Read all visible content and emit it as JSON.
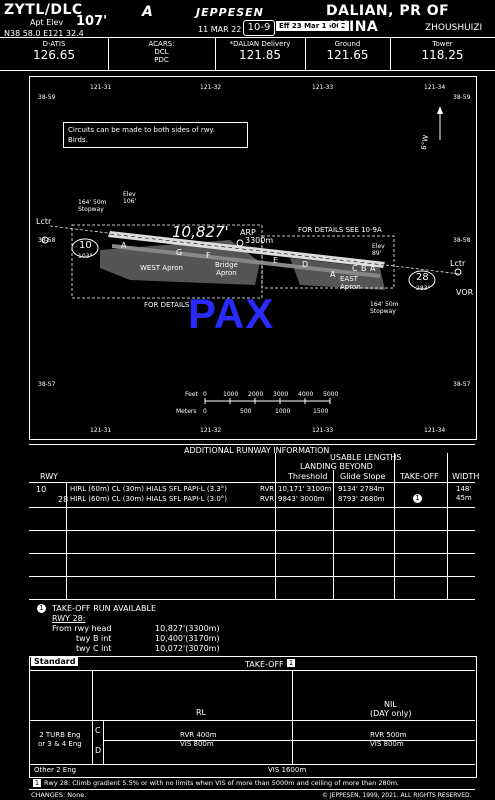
{
  "header": {
    "ident": "ZYTL/DLC",
    "apt_elev_label": "Apt Elev",
    "apt_elev": "107'",
    "coords": "N38 58.0  E121 32.4",
    "brand": "JEPPESEN",
    "date": "11 MAR 22",
    "chart_no": "10-9",
    "effective": "Eff 23 Mar 1600Z",
    "city": "DALIAN, PR OF CHINA",
    "airport": "ZHOUSHUIZI"
  },
  "frequencies": [
    {
      "label": "D-ATIS",
      "value": "126.65"
    },
    {
      "label": "ACARS:",
      "sub": "DCL\nPDC",
      "value": ""
    },
    {
      "label": "*DALIAN Delivery",
      "value": "121.85"
    },
    {
      "label": "Ground",
      "value": "121.65"
    },
    {
      "label": "Tower",
      "value": "118.25"
    }
  ],
  "map": {
    "lon_ticks": [
      "121-31",
      "121-32",
      "121-33",
      "121-34"
    ],
    "lat_ticks": [
      "38-59",
      "38-58",
      "38-57"
    ],
    "note": "Circuits can be made to both sides of rwy.\nBirds.",
    "var": "6°W",
    "runway_length": "10,827'",
    "runway_length_m": "3300m",
    "rwy10": "10",
    "rwy10_hdg": "103°",
    "rwy28": "28",
    "rwy28_hdg": "283°",
    "elev_w": "Elev\n106'",
    "elev_e": "Elev\n89'",
    "stopway_w": "164' 50m\nStopway",
    "stopway_e": "164' 50m\nStopway",
    "arp": "ARP",
    "for_details_1": "FOR DETAILS SEE 10-9A",
    "for_details_2": "FOR DETAILS",
    "west_apron": "WEST Apron",
    "bridge_apron": "Bridge\nApron",
    "east_apron": "EAST\nApron",
    "taxiways": [
      "A",
      "G",
      "F",
      "E",
      "D",
      "A",
      "C",
      "B",
      "A"
    ],
    "lctr": "Lctr",
    "vor": "VOR",
    "watermark": "PAX",
    "scale_feet_label": "Feet",
    "scale_feet": [
      "0",
      "1000",
      "2000",
      "3000",
      "4000",
      "5000"
    ],
    "scale_m_label": "Meters",
    "scale_m": [
      "0",
      "500",
      "1000",
      "1500"
    ]
  },
  "add_rwy_info": {
    "title": "ADDITIONAL RUNWAY INFORMATION",
    "usable": "USABLE LENGTHS",
    "landing_beyond": "LANDING BEYOND",
    "threshold": "Threshold",
    "glide_slope": "Glide Slope",
    "takeoff": "TAKE-OFF",
    "width": "WIDTH",
    "rwy": "RWY",
    "rows": [
      {
        "rwy": "10",
        "lights": "HIRL (60m)  CL (30m)  HIALS  SFL  PAPI-L (3.3°)",
        "rvr": "RVR",
        "thr": "10,171' 3100m",
        "gs": "9134' 2784m",
        "to": "",
        "width": "148'\n45m"
      },
      {
        "rwy": "28",
        "lights": "HIRL (60m)  CL (30m)  HIALS  SFL  PAPI-L (3.0°)",
        "rvr": "RVR",
        "thr": "9843' 3000m",
        "gs": "8793' 2680m",
        "to": "1",
        "width": ""
      }
    ]
  },
  "takeoff_run": {
    "title": "TAKE-OFF RUN AVAILABLE",
    "rwy": "RWY 28:",
    "rows": [
      {
        "label": "From rwy head",
        "value": "10,827'(3300m)"
      },
      {
        "label": "twy B int",
        "value": "10,400'(3170m)"
      },
      {
        "label": "twy C int",
        "value": "10,072'(3070m)"
      }
    ]
  },
  "takeoff_table": {
    "standard": "Standard",
    "title": "TAKE-OFF",
    "rl": "RL",
    "nil": "NIL",
    "nil_sub": "(DAY only)",
    "eng_label": "2 TURB Eng\nor 3 & 4 Eng",
    "c": "C",
    "d": "D",
    "c_rl": "RVR 400m\nVIS 800m",
    "c_nil": "RVR 500m\nVIS 800m",
    "other": "Other 2 Eng",
    "other_val": "VIS 1600m"
  },
  "footnote": "Rwy 28: Climb gradient 5.5% or with no limits when VIS of more than 5000m and ceiling of more than 280m.",
  "changes": "CHANGES:  None.",
  "copyright": "© JEPPESEN, 1999, 2021. ALL RIGHTS RESERVED."
}
